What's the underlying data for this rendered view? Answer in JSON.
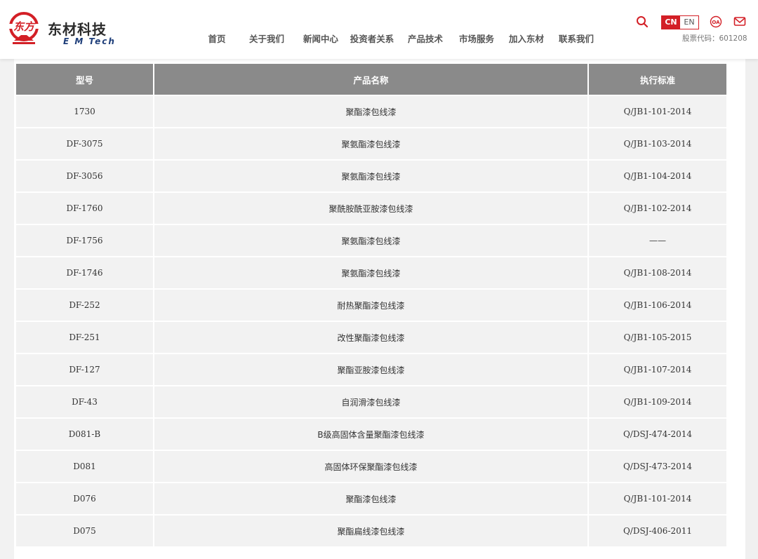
{
  "brand": {
    "logo_mark_text": "东方",
    "name_cn": "东材科技",
    "name_en": "E M Tech"
  },
  "nav": {
    "items": [
      "首页",
      "关于我们",
      "新闻中心",
      "投资者关系",
      "产品技术",
      "市场服务",
      "加入东材",
      "联系我们"
    ]
  },
  "tools": {
    "lang_cn": "CN",
    "lang_en": "EN",
    "oa_label": "OA",
    "stock_code": "股票代码：601208"
  },
  "icons": {
    "search": "search-icon",
    "oa": "oa-icon",
    "mail": "mail-icon"
  },
  "colors": {
    "accent": "#d31f26",
    "table_header_bg": "#8a8a8a",
    "row_bg": "#f2f2f2"
  },
  "table": {
    "headers": [
      "型号",
      "产品名称",
      "执行标准"
    ],
    "rows": [
      [
        "1730",
        "聚酯漆包线漆",
        "Q/JB1-101-2014"
      ],
      [
        "DF-3075",
        "聚氨酯漆包线漆",
        "Q/JB1-103-2014"
      ],
      [
        "DF-3056",
        "聚氨酯漆包线漆",
        "Q/JB1-104-2014"
      ],
      [
        "DF-1760",
        "聚酰胺酰亚胺漆包线漆",
        "Q/JB1-102-2014"
      ],
      [
        "DF-1756",
        "聚氨酯漆包线漆",
        "——"
      ],
      [
        "DF-1746",
        "聚氨酯漆包线漆",
        "Q/JB1-108-2014"
      ],
      [
        "DF-252",
        "耐热聚酯漆包线漆",
        "Q/JB1-106-2014"
      ],
      [
        "DF-251",
        "改性聚酯漆包线漆",
        "Q/JB1-105-2015"
      ],
      [
        "DF-127",
        "聚酯亚胺漆包线漆",
        "Q/JB1-107-2014"
      ],
      [
        "DF-43",
        "自润滑漆包线漆",
        "Q/JB1-109-2014"
      ],
      [
        "D081-B",
        "B级高固体含量聚酯漆包线漆",
        "Q/DSJ-474-2014"
      ],
      [
        "D081",
        "高固体环保聚酯漆包线漆",
        "Q/DSJ-473-2014"
      ],
      [
        "D076",
        "聚酯漆包线漆",
        "Q/JB1-101-2014"
      ],
      [
        "D075",
        "聚酯扁线漆包线漆",
        "Q/DSJ-406-2011"
      ]
    ]
  }
}
